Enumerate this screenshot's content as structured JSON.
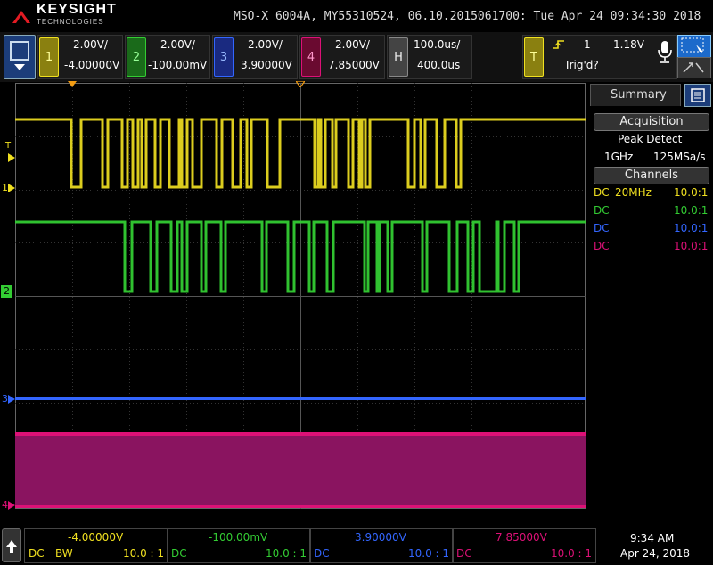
{
  "brand": {
    "name": "KEYSIGHT",
    "sub": "TECHNOLOGIES"
  },
  "title": "MSO-X 6004A, MY55310524, 06.10.2015061700: Tue Apr 24 09:34:30 2018",
  "channels": [
    {
      "num": "1",
      "scale": "2.00V/",
      "offset": "-4.00000V",
      "color": "#f0e020"
    },
    {
      "num": "2",
      "scale": "2.00V/",
      "offset": "-100.00mV",
      "color": "#33cc33"
    },
    {
      "num": "3",
      "scale": "2.00V/",
      "offset": "3.90000V",
      "color": "#3366ff"
    },
    {
      "num": "4",
      "scale": "2.00V/",
      "offset": "7.85000V",
      "color": "#dd1177"
    }
  ],
  "horizontal": {
    "label": "H",
    "scale": "100.0us/",
    "position": "400.0us"
  },
  "trigger": {
    "label": "T",
    "source": "1",
    "level": "1.18V",
    "status": "Trig'd?"
  },
  "side_panel": {
    "tab": "Summary",
    "acquisition_head": "Acquisition",
    "acq_mode": "Peak Detect",
    "bandwidth": "1GHz",
    "sample_rate": "125MSa/s",
    "channels_head": "Channels",
    "rows": [
      {
        "coupling": "DC",
        "extra": "20MHz",
        "probe": "10.0:1",
        "color": "#f0e020"
      },
      {
        "coupling": "DC",
        "extra": "",
        "probe": "10.0:1",
        "color": "#33cc33"
      },
      {
        "coupling": "DC",
        "extra": "",
        "probe": "10.0:1",
        "color": "#3366ff"
      },
      {
        "coupling": "DC",
        "extra": "",
        "probe": "10.0:1",
        "color": "#dd1177"
      }
    ]
  },
  "bottom": {
    "cells": [
      {
        "offset": "-4.00000V",
        "coupling": "DC",
        "extra": "BW",
        "probe": "10.0 : 1",
        "color": "#f0e020"
      },
      {
        "offset": "-100.00mV",
        "coupling": "DC",
        "extra": "",
        "probe": "10.0 : 1",
        "color": "#33cc33"
      },
      {
        "offset": "3.90000V",
        "coupling": "DC",
        "extra": "",
        "probe": "10.0 : 1",
        "color": "#3366ff"
      },
      {
        "offset": "7.85000V",
        "coupling": "DC",
        "extra": "",
        "probe": "10.0 : 1",
        "color": "#dd1177"
      }
    ],
    "time": "9:34 AM",
    "date": "Apr 24, 2018"
  },
  "markers": {
    "trigger_marker": "T",
    "ch1": "1",
    "ch2": "2",
    "ch3": "3",
    "ch4": "4"
  }
}
